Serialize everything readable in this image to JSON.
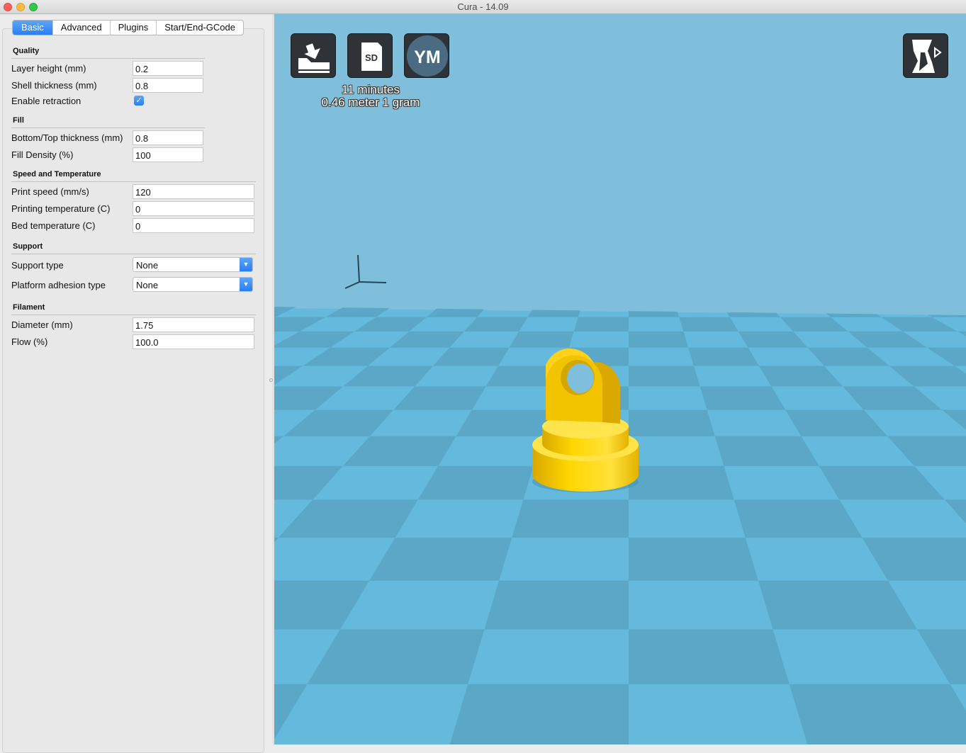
{
  "window": {
    "title": "Cura - 14.09"
  },
  "tabs": [
    {
      "label": "Basic",
      "active": true
    },
    {
      "label": "Advanced",
      "active": false
    },
    {
      "label": "Plugins",
      "active": false
    },
    {
      "label": "Start/End-GCode",
      "active": false
    }
  ],
  "quality": {
    "header": "Quality",
    "layer_height": {
      "label": "Layer height (mm)",
      "value": "0.2"
    },
    "shell_thickness": {
      "label": "Shell thickness (mm)",
      "value": "0.8"
    },
    "enable_retraction": {
      "label": "Enable retraction",
      "checked": true,
      "glyph": "✓"
    }
  },
  "fill": {
    "header": "Fill",
    "bottom_top_thickness": {
      "label": "Bottom/Top thickness (mm)",
      "value": "0.8"
    },
    "fill_density": {
      "label": "Fill Density (%)",
      "value": "100"
    }
  },
  "speed": {
    "header": "Speed and Temperature",
    "print_speed": {
      "label": "Print speed (mm/s)",
      "value": "120"
    },
    "printing_temperature": {
      "label": "Printing temperature (C)",
      "value": "0"
    },
    "bed_temperature": {
      "label": "Bed temperature (C)",
      "value": "0"
    }
  },
  "support": {
    "header": "Support",
    "support_type": {
      "label": "Support type",
      "value": "None"
    },
    "platform_adhesion": {
      "label": "Platform adhesion type",
      "value": "None"
    }
  },
  "filament": {
    "header": "Filament",
    "diameter": {
      "label": "Diameter (mm)",
      "value": "1.75"
    },
    "flow": {
      "label": "Flow (%)",
      "value": "100.0"
    }
  },
  "viewport": {
    "sd_label": "SD",
    "ym_label": "YM",
    "print_time": "11 minutes",
    "material": "0.46 meter 1 gram",
    "colors": {
      "model": "#ffd700",
      "floor_light": "#65b9dc",
      "floor_dark": "#5aa7c8",
      "background": "#80bfdb"
    }
  }
}
